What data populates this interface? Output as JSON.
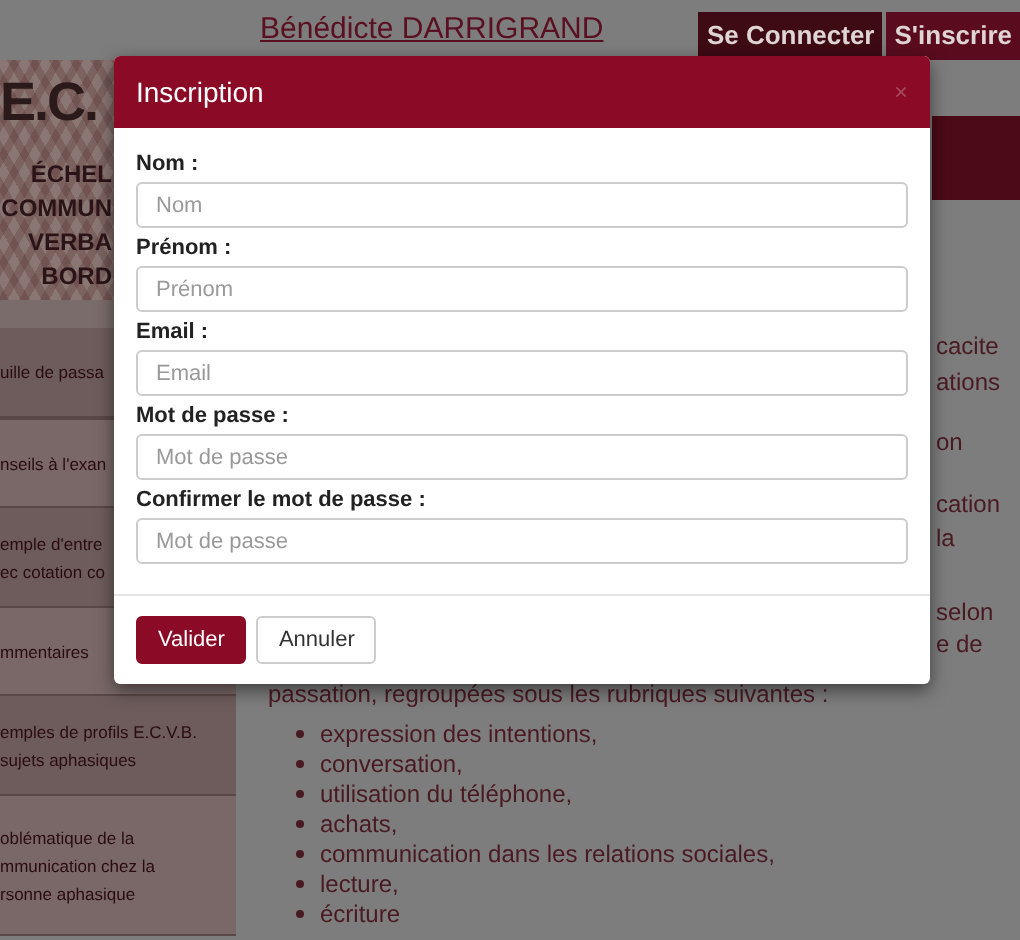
{
  "header": {
    "logo": "E.C.",
    "subtitle": [
      "ÉCHEL",
      "COMMUN",
      "VERBA",
      "BORD"
    ],
    "author": "Bénédicte DARRIGRAND",
    "buttons": [
      "Se Connecter",
      "S'inscrire"
    ]
  },
  "sidebar": {
    "items": [
      {
        "lines": [
          "uille de passa"
        ]
      },
      {
        "lines": [
          "nseils à l'exan"
        ]
      },
      {
        "lines": [
          "emple d'entre",
          "ec cotation co"
        ]
      },
      {
        "lines": [
          "mmentaires"
        ]
      },
      {
        "lines": [
          "emples de profils E.C.V.B.",
          "sujets aphasiques"
        ]
      },
      {
        "lines": [
          "oblématique de la",
          "mmunication chez la",
          "rsonne aphasique"
        ]
      }
    ]
  },
  "content": {
    "right_fragments": [
      "cacite",
      "ations",
      "on",
      "cation",
      "la",
      "selon",
      "e de"
    ],
    "paragraph": "passation, regroupées sous les rubriques suivantes :",
    "list": [
      "expression des intentions,",
      "conversation,",
      "utilisation du téléphone,",
      "achats,",
      "communication dans les relations sociales,",
      "lecture,",
      "écriture"
    ]
  },
  "modal": {
    "title": "Inscription",
    "close": "×",
    "fields": [
      {
        "label": "Nom :",
        "placeholder": "Nom"
      },
      {
        "label": "Prénom :",
        "placeholder": "Prénom"
      },
      {
        "label": "Email :",
        "placeholder": "Email"
      },
      {
        "label": "Mot de passe :",
        "placeholder": "Mot de passe"
      },
      {
        "label": "Confirmer le mot de passe :",
        "placeholder": "Mot de passe"
      }
    ],
    "buttons": [
      {
        "label": "Valider",
        "kind": "primary"
      },
      {
        "label": "Annuler",
        "kind": "secondary"
      }
    ]
  }
}
